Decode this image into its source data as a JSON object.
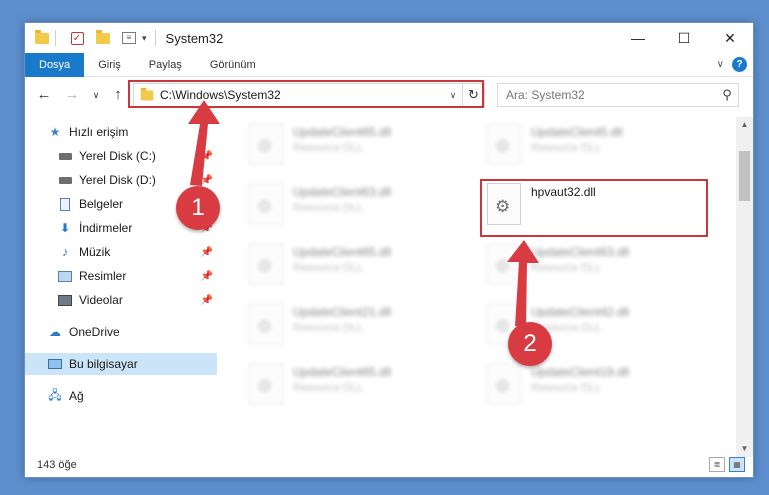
{
  "window": {
    "title": "System32"
  },
  "win_controls": {
    "minimize": "—",
    "maximize": "☐",
    "close": "✕"
  },
  "ribbon": {
    "tabs": [
      "Dosya",
      "Giriş",
      "Paylaş",
      "Görünüm"
    ],
    "help": "?"
  },
  "address": {
    "path": "C:\\Windows\\System32"
  },
  "search": {
    "placeholder": "Ara: System32"
  },
  "sidebar": {
    "items": [
      {
        "label": "Hızlı erişim",
        "icon": "star-icon"
      },
      {
        "label": "Yerel Disk (C:)",
        "icon": "drive-icon",
        "pinned": true
      },
      {
        "label": "Yerel Disk (D:)",
        "icon": "drive-icon",
        "pinned": true
      },
      {
        "label": "Belgeler",
        "icon": "document-icon",
        "pinned": true
      },
      {
        "label": "İndirmeler",
        "icon": "download-icon",
        "pinned": true
      },
      {
        "label": "Müzik",
        "icon": "music-icon",
        "pinned": true
      },
      {
        "label": "Resimler",
        "icon": "picture-icon",
        "pinned": true
      },
      {
        "label": "Videolar",
        "icon": "video-icon",
        "pinned": true
      },
      {
        "label": "OneDrive",
        "icon": "cloud-icon"
      },
      {
        "label": "Bu bilgisayar",
        "icon": "computer-icon",
        "selected": true
      },
      {
        "label": "Ağ",
        "icon": "network-icon"
      }
    ]
  },
  "files": [
    {
      "name": "UpdateClient65.dll",
      "type": "Resource DLL",
      "blurred": true
    },
    {
      "name": "UpdateClient5.dll",
      "type": "Resource DLL",
      "blurred": true
    },
    {
      "name": "UpdateClient63.dll",
      "type": "Resource DLL",
      "blurred": true
    },
    {
      "name": "hpvaut32.dll",
      "type": "",
      "blurred": false
    },
    {
      "name": "UpdateClient65.dll",
      "type": "Resource DLL",
      "blurred": true
    },
    {
      "name": "UpdateClient63.dll",
      "type": "Resource DLL",
      "blurred": true
    },
    {
      "name": "UpdateClient21.dll",
      "type": "Resource DLL",
      "blurred": true
    },
    {
      "name": "UpdateClient42.dll",
      "type": "Resource DLL",
      "blurred": true
    },
    {
      "name": "UpdateClient65.dll",
      "type": "Resource DLL",
      "blurred": true
    },
    {
      "name": "UpdateClient19.dll",
      "type": "Resource DLL",
      "blurred": true
    }
  ],
  "status": {
    "count": "143 öğe"
  },
  "annotations": {
    "callout_1": "1",
    "callout_2": "2",
    "color": "#d93b42"
  }
}
